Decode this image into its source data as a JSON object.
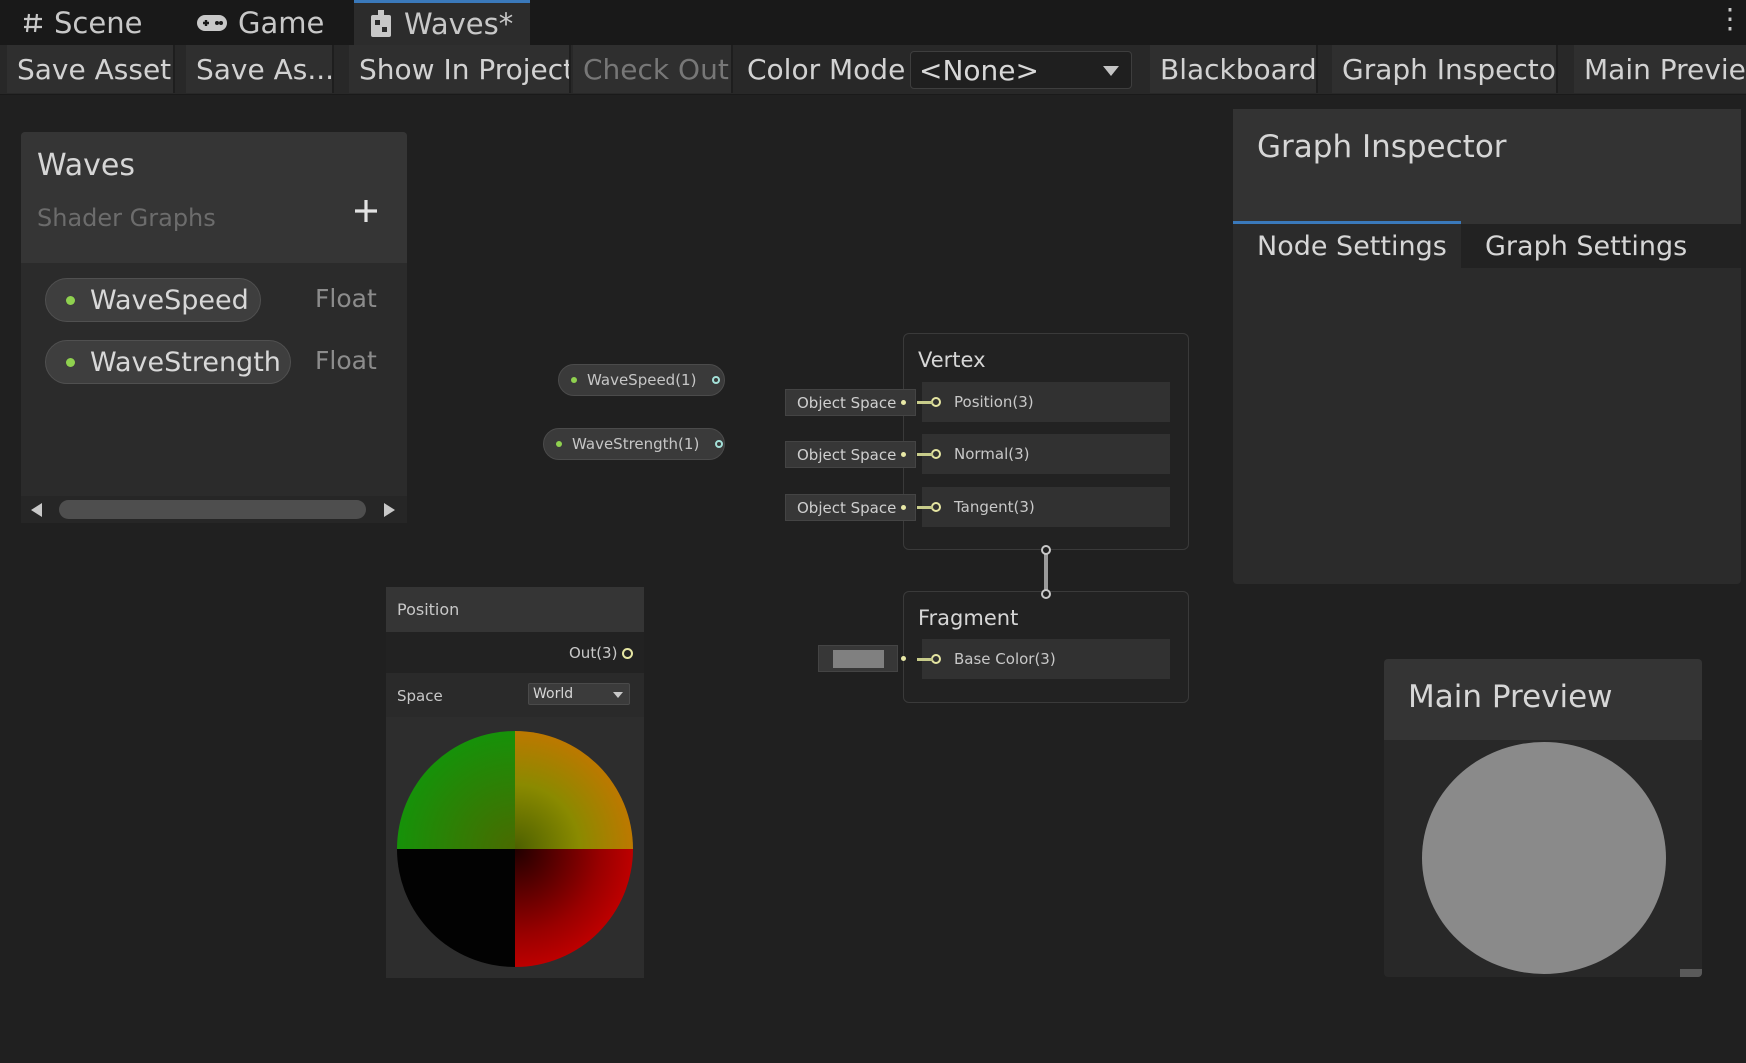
{
  "window_tabs": [
    {
      "label": "Scene",
      "icon": "hash-icon"
    },
    {
      "label": "Game",
      "icon": "gamepad-icon"
    },
    {
      "label": "Waves*",
      "icon": "shader-graph-icon"
    }
  ],
  "toolbar": {
    "save_asset": "Save Asset",
    "save_as": "Save As...",
    "show_in_project": "Show In Project",
    "check_out": "Check Out",
    "color_mode_label": "Color Mode",
    "color_mode_value": "<None>",
    "blackboard": "Blackboard",
    "graph_inspector": "Graph Inspector",
    "main_preview": "Main Preview"
  },
  "blackboard": {
    "title": "Waves",
    "subtitle": "Shader Graphs",
    "properties": [
      {
        "name": "WaveSpeed",
        "type": "Float"
      },
      {
        "name": "WaveStrength",
        "type": "Float"
      }
    ]
  },
  "nodes": {
    "wave_speed": "WaveSpeed(1)",
    "wave_strength": "WaveStrength(1)",
    "position": {
      "title": "Position",
      "output": "Out(3)",
      "space_label": "Space",
      "space_value": "World"
    }
  },
  "master": {
    "vertex_title": "Vertex",
    "vertex_slots": [
      {
        "label": "Position(3)",
        "space": "Object Space"
      },
      {
        "label": "Normal(3)",
        "space": "Object Space"
      },
      {
        "label": "Tangent(3)",
        "space": "Object Space"
      }
    ],
    "fragment_title": "Fragment",
    "fragment_slots": [
      {
        "label": "Base Color(3)",
        "swatch_color": "#808080"
      }
    ]
  },
  "inspector": {
    "title": "Graph Inspector",
    "tabs": [
      "Node Settings",
      "Graph Settings"
    ],
    "active_tab": "Node Settings"
  },
  "preview": {
    "title": "Main Preview",
    "sphere_color": "#8a8a8a"
  },
  "colors": {
    "accent": "#3a79bb",
    "float_port": "#8fd14f",
    "vector3_port": "#e5e5a2",
    "background": "#202020"
  }
}
